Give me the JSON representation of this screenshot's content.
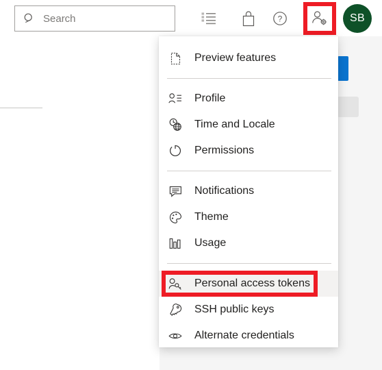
{
  "topbar": {
    "search": {
      "placeholder": "Search",
      "value": "",
      "icon": "search-icon"
    },
    "icons": [
      {
        "name": "boards-checklist-icon",
        "title": "Boards"
      },
      {
        "name": "marketplace-bag-icon",
        "title": "Marketplace"
      },
      {
        "name": "help-question-icon",
        "title": "Help"
      }
    ],
    "user_settings": {
      "name": "user-settings-icon",
      "title": "User settings",
      "highlight_color": "#ee1c25"
    },
    "avatar": {
      "initials": "SB",
      "color": "#0e5128"
    }
  },
  "account_menu": {
    "groups": [
      {
        "items": [
          {
            "label": "Preview features",
            "icon": "page-preview-icon",
            "name": "menu-item-preview-features",
            "highlighted": false
          }
        ]
      },
      {
        "items": [
          {
            "label": "Profile",
            "icon": "profile-person-icon",
            "name": "menu-item-profile",
            "highlighted": false
          },
          {
            "label": "Time and Locale",
            "icon": "clock-globe-icon",
            "name": "menu-item-time-and-locale",
            "highlighted": false
          },
          {
            "label": "Permissions",
            "icon": "permissions-refresh-icon",
            "name": "menu-item-permissions",
            "highlighted": false
          }
        ]
      },
      {
        "items": [
          {
            "label": "Notifications",
            "icon": "notifications-comment-icon",
            "name": "menu-item-notifications",
            "highlighted": false
          },
          {
            "label": "Theme",
            "icon": "theme-palette-icon",
            "name": "menu-item-theme",
            "highlighted": false
          },
          {
            "label": "Usage",
            "icon": "usage-bar-chart-icon",
            "name": "menu-item-usage",
            "highlighted": false
          }
        ]
      },
      {
        "items": [
          {
            "label": "Personal access tokens",
            "icon": "personal-access-token-key-icon",
            "name": "menu-item-personal-access-tokens",
            "highlighted": true
          },
          {
            "label": "SSH public keys",
            "icon": "ssh-key-icon",
            "name": "menu-item-ssh-public-keys",
            "highlighted": false
          },
          {
            "label": "Alternate credentials",
            "icon": "alternate-credentials-eye-icon",
            "name": "menu-item-alternate-credentials",
            "highlighted": false
          }
        ]
      }
    ],
    "highlight_color": "#ee1c25"
  },
  "background": {
    "primary_button_color": "#0a74d0",
    "card_color": "#e4e4e4",
    "page_color": "#f5f5f5"
  }
}
